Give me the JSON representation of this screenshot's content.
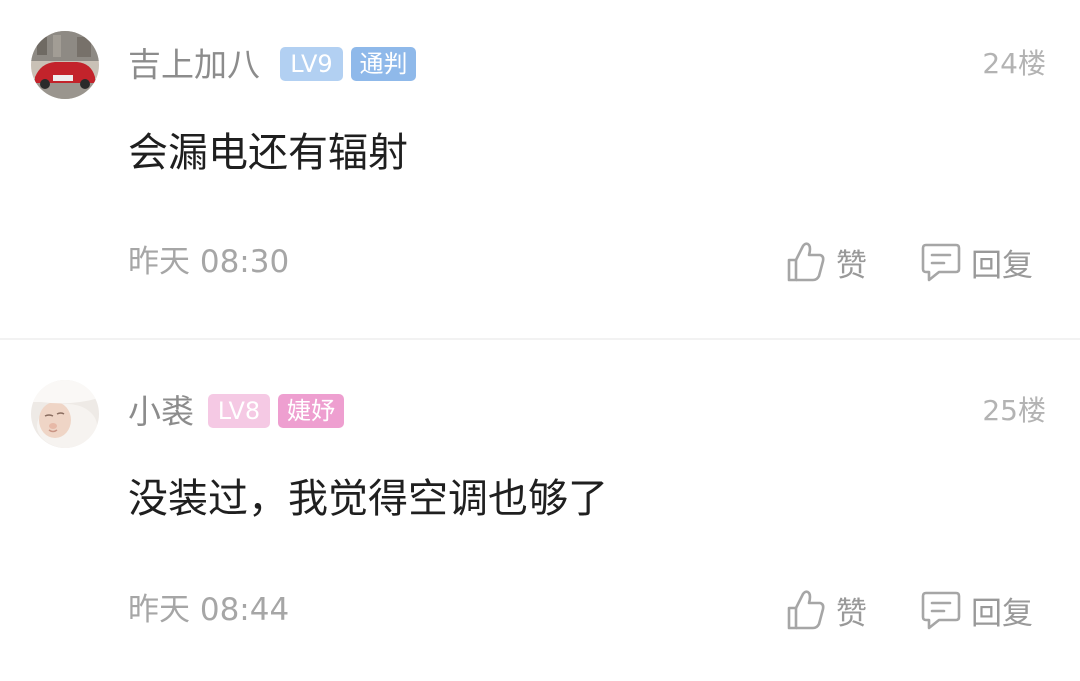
{
  "comments": [
    {
      "username": "吉上加八",
      "level": "LV9",
      "title_badge": "通判",
      "floor": "24楼",
      "content": "会漏电还有辐射",
      "time": "昨天 08:30",
      "like_label": "赞",
      "reply_label": "回复",
      "colors": {
        "level_badge": "#b2d0f2",
        "title_badge": "#8fb9ea"
      }
    },
    {
      "username": "小裘",
      "level": "LV8",
      "title_badge": "婕妤",
      "floor": "25楼",
      "content": "没装过，我觉得空调也够了",
      "time": "昨天 08:44",
      "like_label": "赞",
      "reply_label": "回复",
      "colors": {
        "level_badge": "#f5c9e4",
        "title_badge": "#ee9fd0"
      }
    }
  ],
  "icons": {
    "like": "thumbs-up-icon",
    "reply": "comment-bubble-icon"
  }
}
